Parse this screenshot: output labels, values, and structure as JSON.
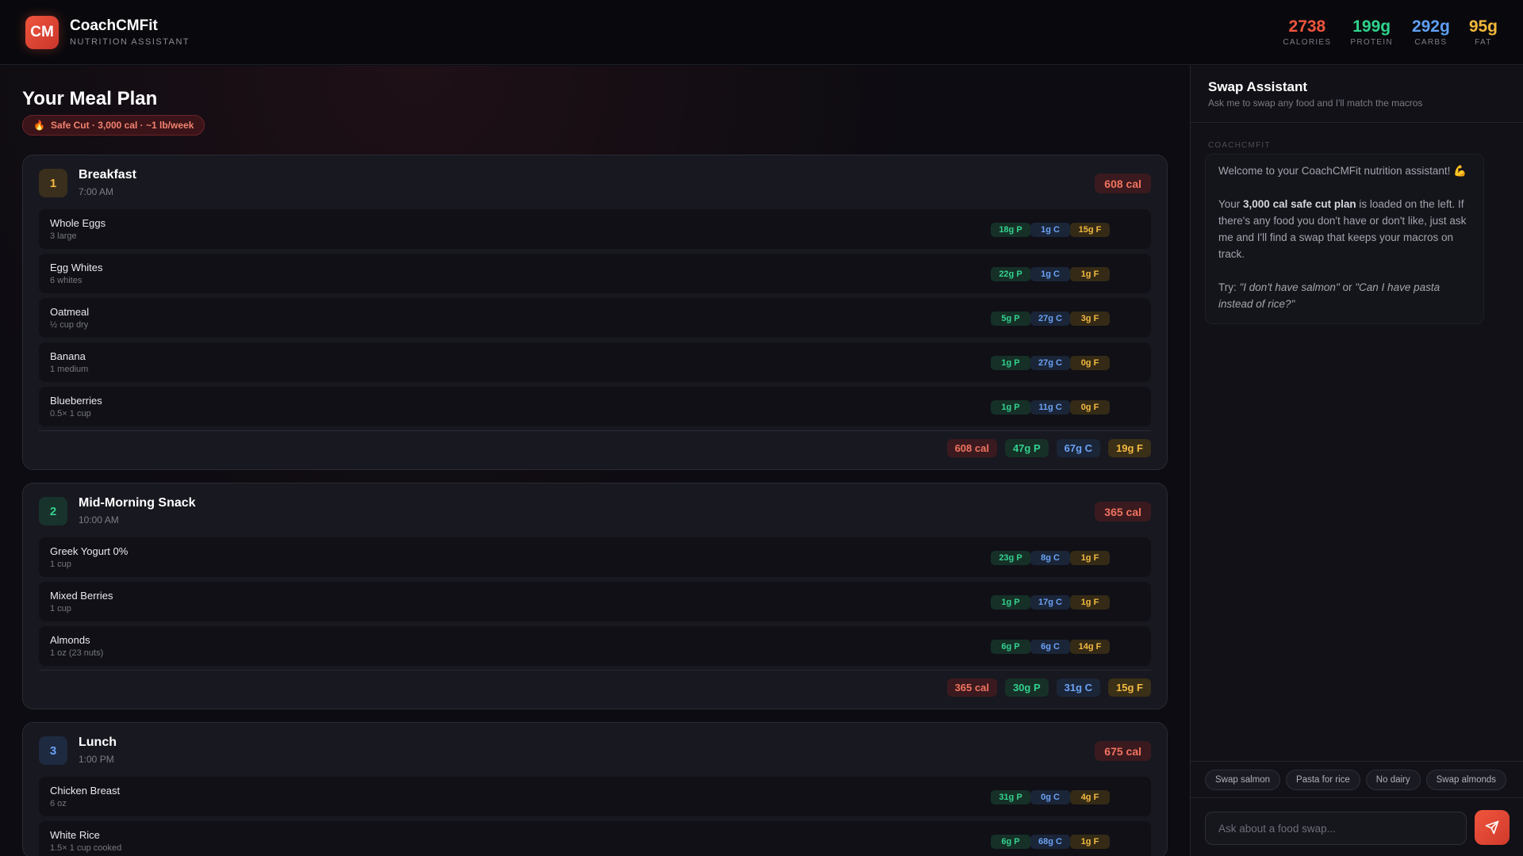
{
  "app": {
    "logo": "CM",
    "name": "CoachCMFit",
    "subtitle": "NUTRITION ASSISTANT"
  },
  "stats": [
    {
      "value": "2738",
      "label": "CALORIES",
      "color": "#f0553d"
    },
    {
      "value": "199g",
      "label": "PROTEIN",
      "color": "#2fd38d"
    },
    {
      "value": "292g",
      "label": "CARBS",
      "color": "#5fa0f5"
    },
    {
      "value": "95g",
      "label": "FAT",
      "color": "#f3b73a"
    }
  ],
  "plan": {
    "title": "Your Meal Plan",
    "badge_icon": "🔥",
    "badge": "Safe Cut · 3,000 cal · ~1 lb/week"
  },
  "meals": [
    {
      "num": "1",
      "name": "Breakfast",
      "time": "7:00 AM",
      "cal": "608 cal",
      "num_bg": "#3a2f1c",
      "num_color": "#f2b940",
      "foods": [
        {
          "name": "Whole Eggs",
          "qty": "3 large",
          "p": "18g P",
          "c": "1g C",
          "f": "15g F"
        },
        {
          "name": "Egg Whites",
          "qty": "6 whites",
          "p": "22g P",
          "c": "1g C",
          "f": "1g F"
        },
        {
          "name": "Oatmeal",
          "qty": "½ cup dry",
          "p": "5g P",
          "c": "27g C",
          "f": "3g F"
        },
        {
          "name": "Banana",
          "qty": "1 medium",
          "p": "1g P",
          "c": "27g C",
          "f": "0g F"
        },
        {
          "name": "Blueberries",
          "qty": "0.5× 1 cup",
          "p": "1g P",
          "c": "11g C",
          "f": "0g F"
        }
      ],
      "totals": {
        "cal": "608 cal",
        "p": "47g P",
        "c": "67g C",
        "f": "19g F"
      }
    },
    {
      "num": "2",
      "name": "Mid-Morning Snack",
      "time": "10:00 AM",
      "cal": "365 cal",
      "num_bg": "#17332b",
      "num_color": "#34d18f",
      "foods": [
        {
          "name": "Greek Yogurt 0%",
          "qty": "1 cup",
          "p": "23g P",
          "c": "8g C",
          "f": "1g F"
        },
        {
          "name": "Mixed Berries",
          "qty": "1 cup",
          "p": "1g P",
          "c": "17g C",
          "f": "1g F"
        },
        {
          "name": "Almonds",
          "qty": "1 oz (23 nuts)",
          "p": "6g P",
          "c": "6g C",
          "f": "14g F"
        }
      ],
      "totals": {
        "cal": "365 cal",
        "p": "30g P",
        "c": "31g C",
        "f": "15g F"
      }
    },
    {
      "num": "3",
      "name": "Lunch",
      "time": "1:00 PM",
      "cal": "675 cal",
      "num_bg": "#1e2a40",
      "num_color": "#6aa2f5",
      "foods": [
        {
          "name": "Chicken Breast",
          "qty": "6 oz",
          "p": "31g P",
          "c": "0g C",
          "f": "4g F"
        },
        {
          "name": "White Rice",
          "qty": "1.5× 1 cup cooked",
          "p": "6g P",
          "c": "68g C",
          "f": "1g F"
        }
      ]
    }
  ],
  "sidebar": {
    "title": "Swap Assistant",
    "subtitle": "Ask me to swap any food and I'll match the macros",
    "message": {
      "author": "COACHCMFIT",
      "p1": "Welcome to your CoachCMFit nutrition assistant! 💪",
      "p2_pre": "Your ",
      "p2_bold": "3,000 cal safe cut plan",
      "p2_post": " is loaded on the left. If there's any food you don't have or don't like, just ask me and I'll find a swap that keeps your macros on track.",
      "p3_pre": "Try: ",
      "p3_q1": "\"I don't have salmon\"",
      "p3_mid": " or ",
      "p3_q2": "\"Can I have pasta instead of rice?\""
    },
    "quick_swaps": [
      "Swap salmon",
      "Pasta for rice",
      "No dairy",
      "Swap almonds"
    ],
    "input_placeholder": "Ask about a food swap...",
    "input_value": ""
  }
}
